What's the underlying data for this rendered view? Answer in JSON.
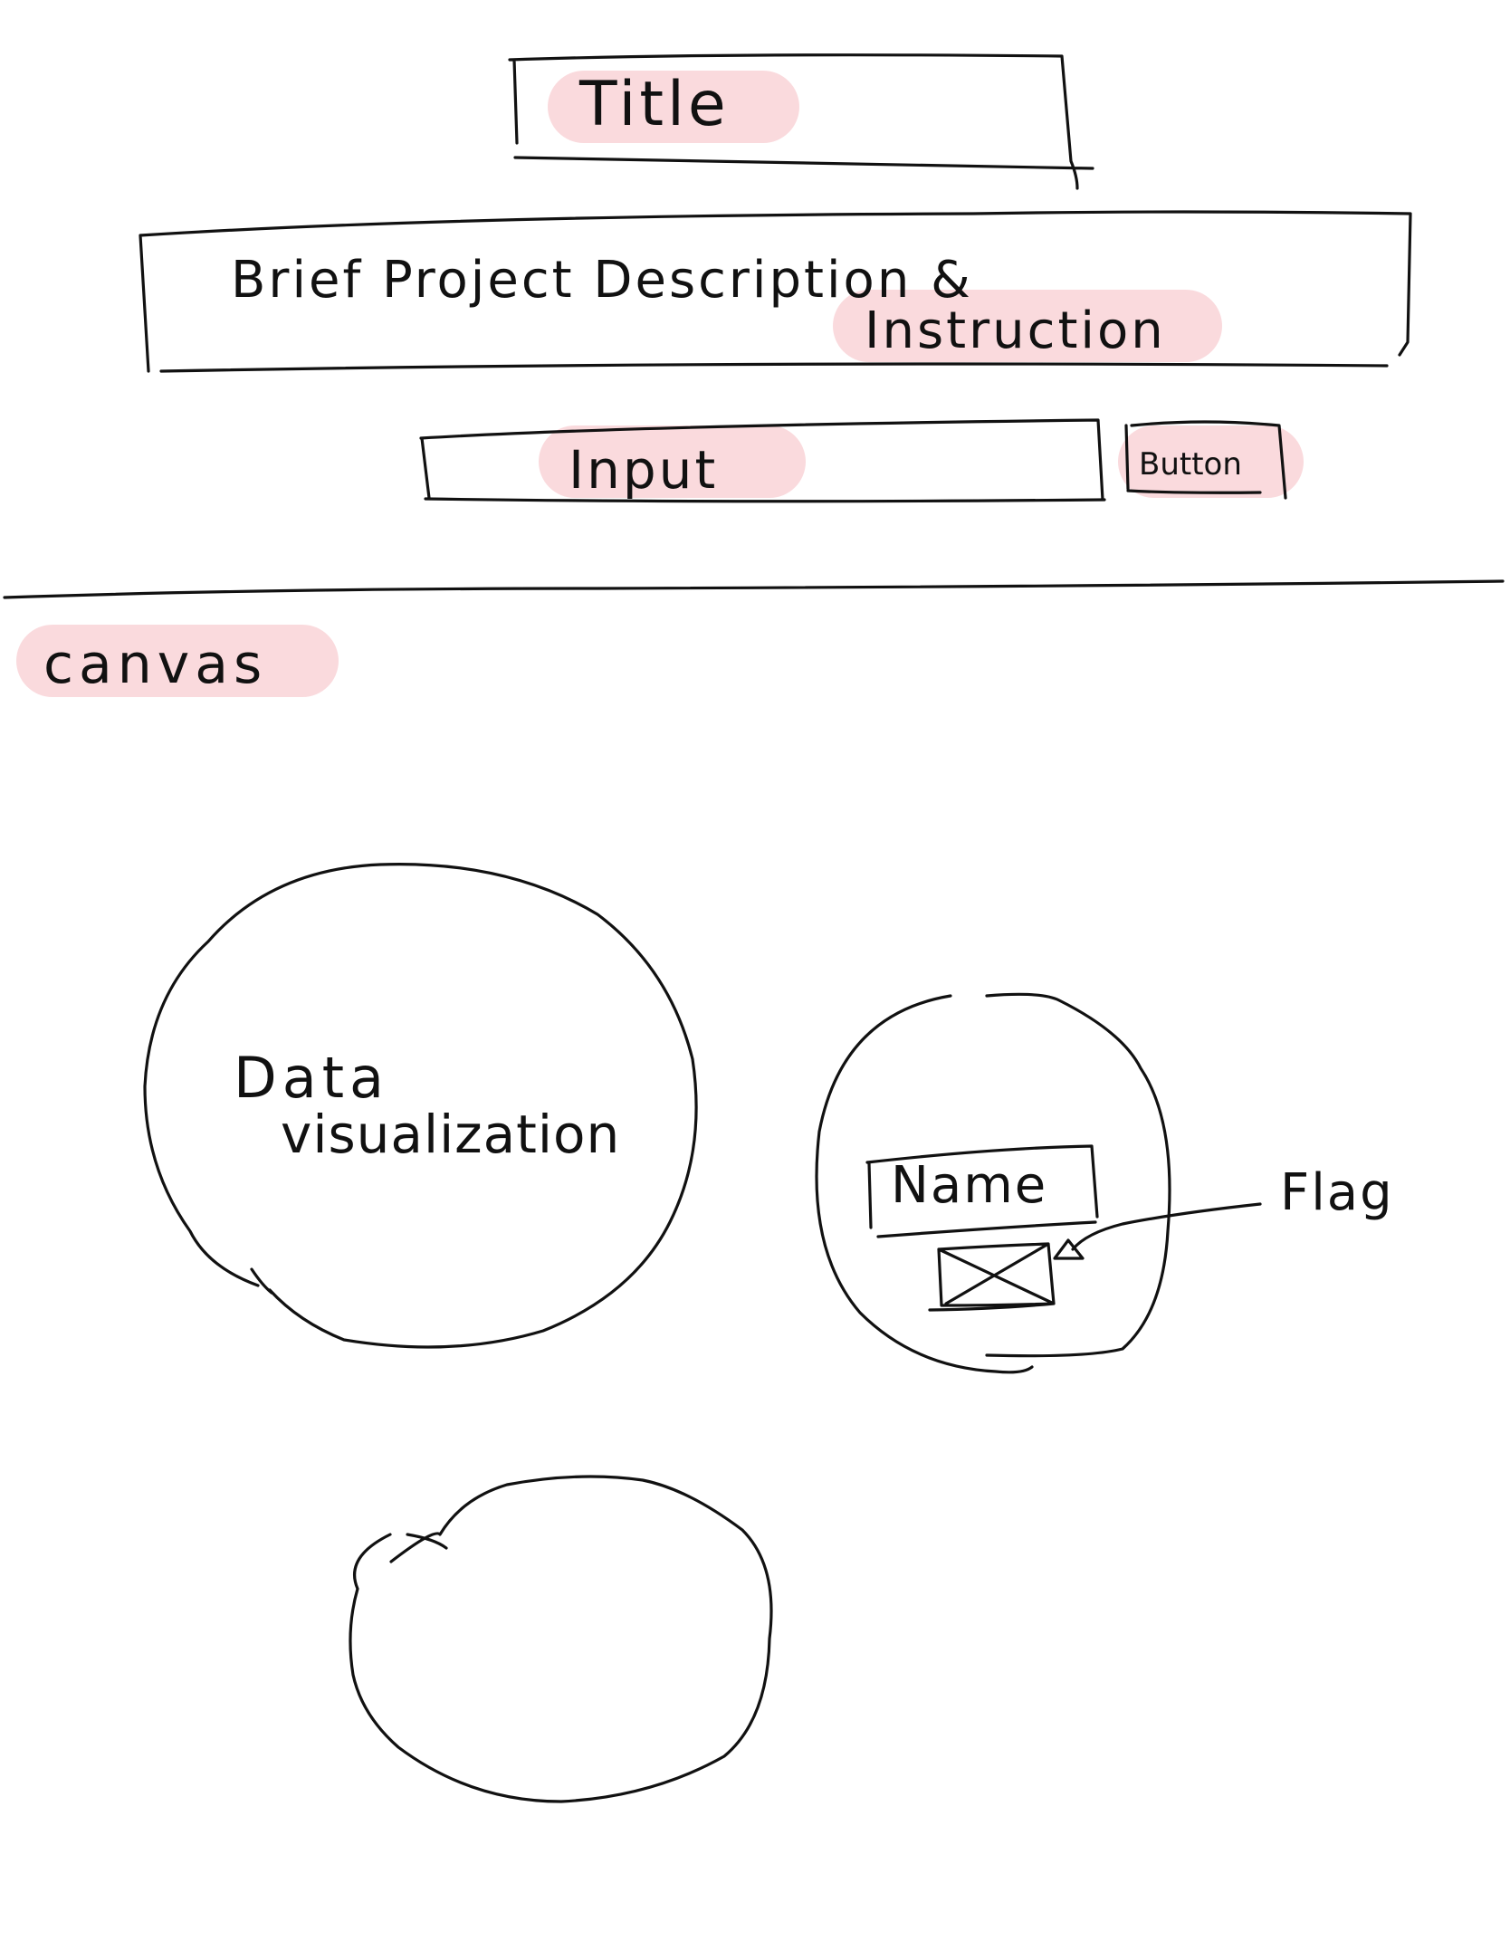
{
  "colors": {
    "ink": "#111111",
    "highlight": "#fadadd",
    "background": "#ffffff"
  },
  "header": {
    "title": "Title",
    "description_line1": "Brief Project Description &",
    "description_line2": "Instruction"
  },
  "controls": {
    "input_label": "Input",
    "button_label": "Button"
  },
  "canvas": {
    "label": "canvas",
    "data_viz_line1": "Data",
    "data_viz_line2": "visualization",
    "node_name": "Name",
    "flag_label": "Flag",
    "image_placeholder_icon": "image-placeholder-icon"
  }
}
